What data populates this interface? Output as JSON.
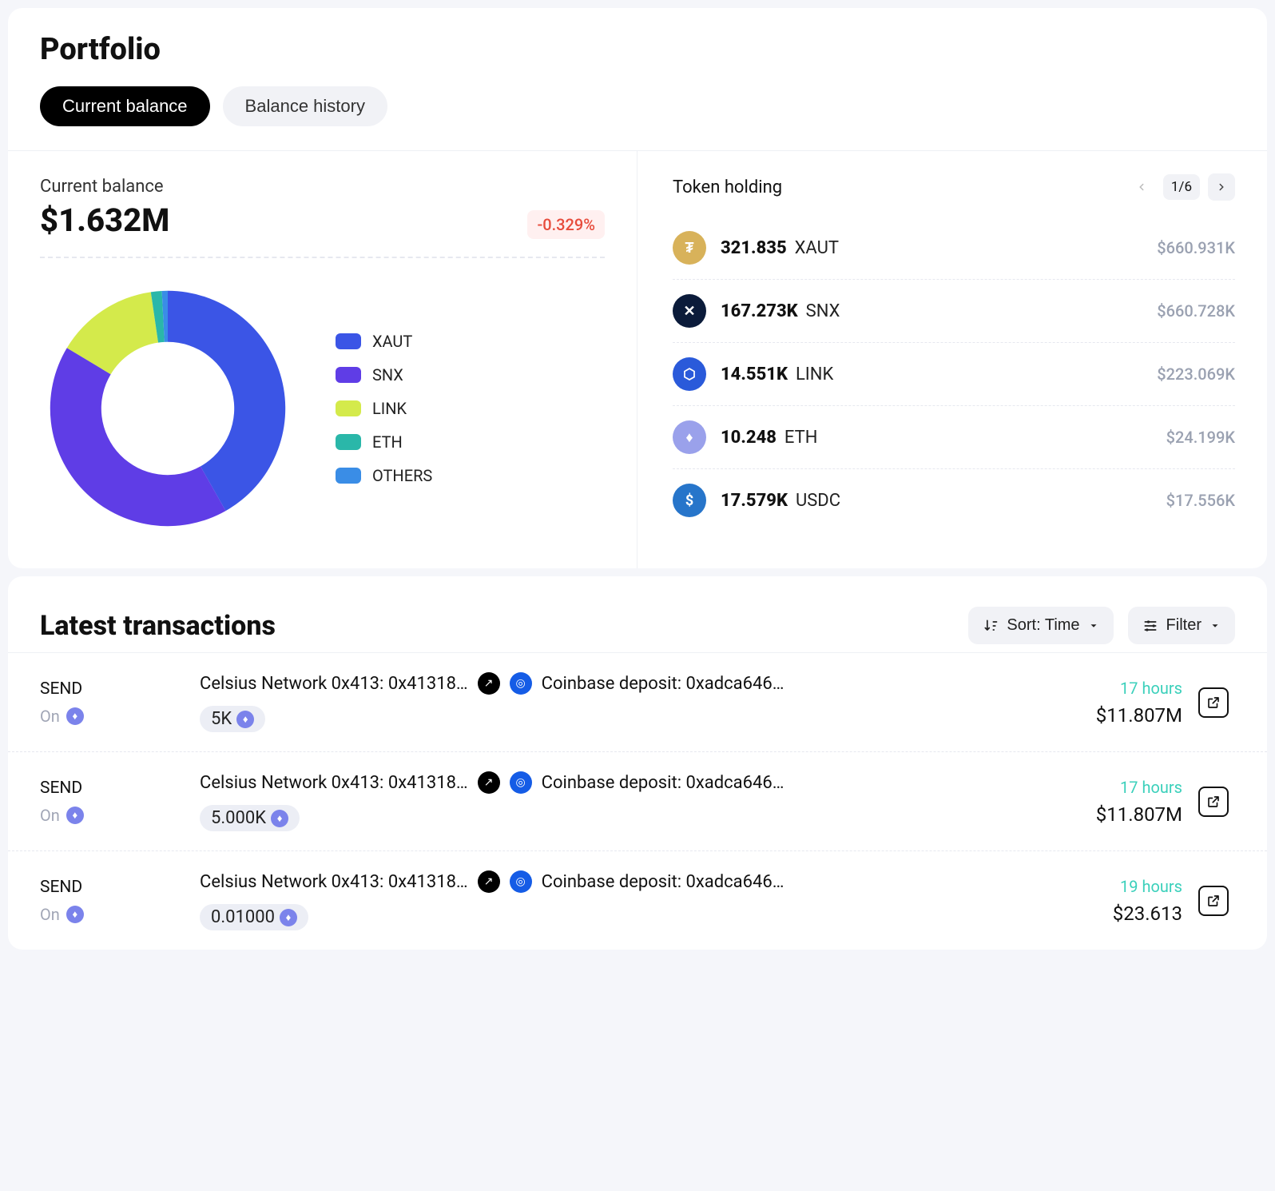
{
  "chart_data": {
    "type": "pie",
    "title": "Current balance",
    "series": [
      {
        "name": "XAUT",
        "value": 41.8,
        "color": "#3b55e6"
      },
      {
        "name": "SNX",
        "value": 41.8,
        "color": "#5f3de6"
      },
      {
        "name": "LINK",
        "value": 14.1,
        "color": "#d4ea4b"
      },
      {
        "name": "ETH",
        "value": 1.5,
        "color": "#2ab7a9"
      },
      {
        "name": "OTHERS",
        "value": 0.8,
        "color": "#3a8de6"
      }
    ],
    "note": "percent of portfolio; inner radius ~55%"
  },
  "header": {
    "title": "Portfolio",
    "tab_active": "Current balance",
    "tab_inactive": "Balance history"
  },
  "balance": {
    "label": "Current balance",
    "value": "$1.632M",
    "change": "-0.329%"
  },
  "legend": [
    {
      "label": "XAUT",
      "color": "#3b55e6"
    },
    {
      "label": "SNX",
      "color": "#5f3de6"
    },
    {
      "label": "LINK",
      "color": "#d4ea4b"
    },
    {
      "label": "ETH",
      "color": "#2ab7a9"
    },
    {
      "label": "OTHERS",
      "color": "#3a8de6"
    }
  ],
  "holdings": {
    "title": "Token holding",
    "page": "1/6",
    "items": [
      {
        "amount": "321.835",
        "symbol": "XAUT",
        "value": "$660.931K",
        "bg": "#d8b25a",
        "glyph": "₮"
      },
      {
        "amount": "167.273K",
        "symbol": "SNX",
        "value": "$660.728K",
        "bg": "#0b1b3a",
        "glyph": "✕"
      },
      {
        "amount": "14.551K",
        "symbol": "LINK",
        "value": "$223.069K",
        "bg": "#2a5ada",
        "glyph": "⬡"
      },
      {
        "amount": "10.248",
        "symbol": "ETH",
        "value": "$24.199K",
        "bg": "#9aa1eb",
        "glyph": "♦"
      },
      {
        "amount": "17.579K",
        "symbol": "USDC",
        "value": "$17.556K",
        "bg": "#2775ca",
        "glyph": "$"
      }
    ]
  },
  "transactions": {
    "title": "Latest transactions",
    "sort_label": "Sort: Time",
    "filter_label": "Filter",
    "items": [
      {
        "type": "SEND",
        "on": "On",
        "line": "Celsius Network 0x413: 0x41318…",
        "dest": "Coinbase deposit: 0xadca646…",
        "chip": "5K",
        "time": "17 hours",
        "amount": "$11.807M"
      },
      {
        "type": "SEND",
        "on": "On",
        "line": "Celsius Network 0x413: 0x41318…",
        "dest": "Coinbase deposit: 0xadca646…",
        "chip": "5.000K",
        "time": "17 hours",
        "amount": "$11.807M"
      },
      {
        "type": "SEND",
        "on": "On",
        "line": "Celsius Network 0x413: 0x41318…",
        "dest": "Coinbase deposit: 0xadca646…",
        "chip": "0.01000",
        "time": "19 hours",
        "amount": "$23.613"
      }
    ]
  }
}
